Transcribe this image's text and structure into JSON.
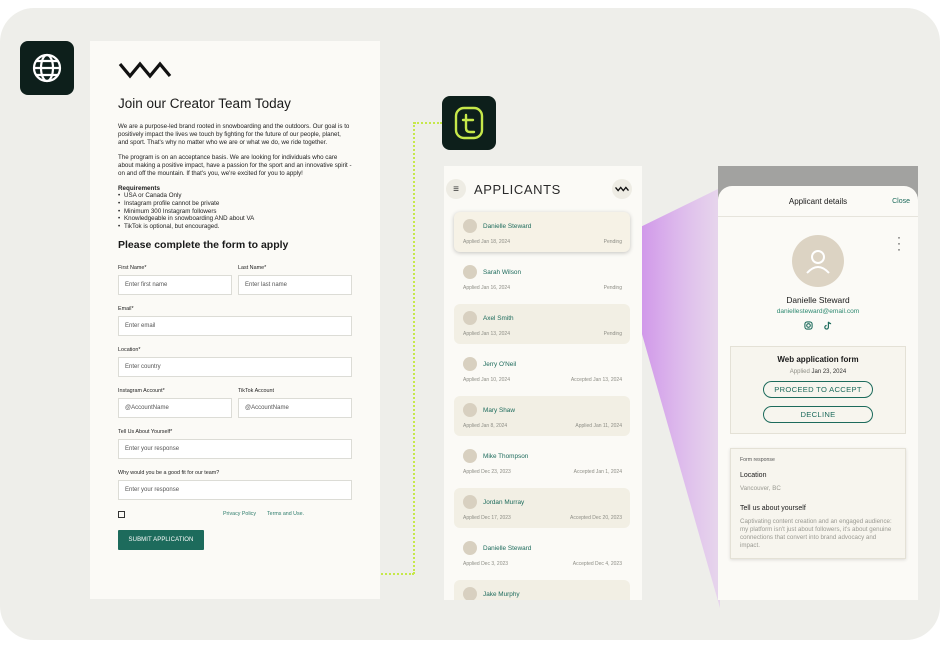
{
  "form": {
    "heading": "Join our Creator Team Today",
    "intro_1": "We are a purpose-led brand rooted in snowboarding and the outdoors. Our goal is to positively impact the lives we touch by fighting for the future of our people, planet, and sport. That's why no matter who we are or what we do, we ride together.",
    "intro_2": "The program is on an acceptance basis. We are looking for individuals who care about making a positive impact, have a passion for the sport and an innovative spirit - on and off the mountain. If that's you, we're excited for you to apply!",
    "requirements_title": "Requirements",
    "requirements": [
      "USA or Canada Only",
      "Instagram profile cannot be private",
      "Minimum 300 Instagram followers",
      "Knowledgeable in snowboarding AND about VA",
      "TikTok is optional, but encouraged."
    ],
    "subheading": "Please complete the form to apply",
    "fields": {
      "first_name": {
        "label": "First Name*",
        "placeholder": "Enter first name"
      },
      "last_name": {
        "label": "Last Name*",
        "placeholder": "Enter last name"
      },
      "email": {
        "label": "Email*",
        "placeholder": "Enter email"
      },
      "location": {
        "label": "Location*",
        "placeholder": "Enter country"
      },
      "instagram": {
        "label": "Instagram Account*",
        "placeholder": "@AccountName"
      },
      "tiktok": {
        "label": "TikTok Account",
        "placeholder": "@AccountName"
      },
      "about": {
        "label": "Tell Us About Yourself*",
        "placeholder": "Enter your response"
      },
      "fit": {
        "label": "Why would you be a good fit for our team?",
        "placeholder": "Enter your response"
      }
    },
    "privacy_link": "Privacy Policy",
    "terms_link": "Terms and Use.",
    "submit_label": "SUBMIT APPLICATION"
  },
  "applicants": {
    "title": "APPLICANTS",
    "items": [
      {
        "name": "Danielle Steward",
        "applied": "Applied Jan 18, 2024",
        "status": "Pending"
      },
      {
        "name": "Sarah Wilson",
        "applied": "Applied Jan 16, 2024",
        "status": "Pending"
      },
      {
        "name": "Axel Smith",
        "applied": "Applied Jan 13, 2024",
        "status": "Pending"
      },
      {
        "name": "Jerry O'Neil",
        "applied": "Applied Jan 10, 2024",
        "status": "Accepted Jan 13, 2024"
      },
      {
        "name": "Mary Shaw",
        "applied": "Applied Jan 8, 2024",
        "status": "Applied Jan 11, 2024"
      },
      {
        "name": "Mike Thompson",
        "applied": "Applied Dec 23, 2023",
        "status": "Accepted Jan 1, 2024"
      },
      {
        "name": "Jordan Murray",
        "applied": "Applied Dec 17, 2023",
        "status": "Accepted Dec 20, 2023"
      },
      {
        "name": "Danielle Steward",
        "applied": "Applied Dec 3, 2023",
        "status": "Accepted Dec 4, 2023"
      },
      {
        "name": "Jake Murphy",
        "applied": "",
        "status": ""
      }
    ]
  },
  "detail": {
    "title": "Applicant details",
    "close_label": "Close",
    "name": "Danielle Steward",
    "email": "daniellesteward@email.com",
    "web_form_title": "Web application form",
    "applied_prefix": "Applied",
    "applied_date": "Jan 23, 2024",
    "accept_label": "PROCEED TO ACCEPT",
    "decline_label": "DECLINE",
    "response_caption": "Form response",
    "location_label": "Location",
    "location_value": "Vancouver, BC",
    "about_label": "Tell us about yourself",
    "about_value": "Captivating content creation and an engaged audience: my platform isn't just about followers, it's about genuine connections that convert into brand advocacy and impact."
  },
  "colors": {
    "accent": "#1d6b5c",
    "lime": "#c6e84a",
    "purple": "#c77ee8",
    "dark_icon": "#0d1f1b"
  }
}
